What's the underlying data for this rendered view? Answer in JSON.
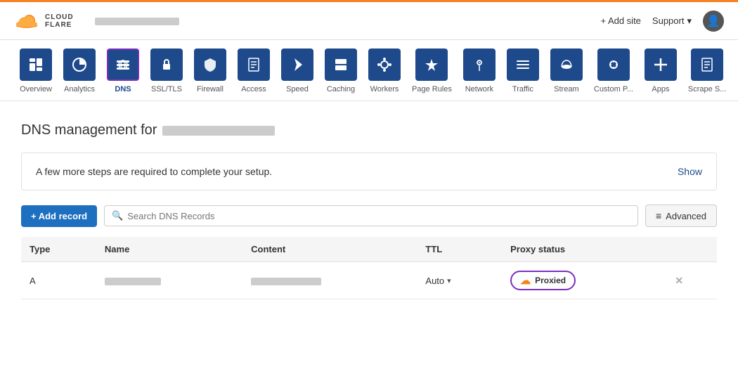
{
  "header": {
    "logo_text": "CLOUDFLARE",
    "site_name": "██████████",
    "add_site_label": "+ Add site",
    "support_label": "Support",
    "user_icon": "👤"
  },
  "nav": {
    "tabs": [
      {
        "id": "overview",
        "label": "Overview",
        "icon": "≡",
        "active": false
      },
      {
        "id": "analytics",
        "label": "Analytics",
        "icon": "◔",
        "active": false
      },
      {
        "id": "dns",
        "label": "DNS",
        "icon": "⊞",
        "active": true
      },
      {
        "id": "ssl-tls",
        "label": "SSL/TLS",
        "icon": "🔒",
        "active": false
      },
      {
        "id": "firewall",
        "label": "Firewall",
        "icon": "⊓",
        "active": false
      },
      {
        "id": "access",
        "label": "Access",
        "icon": "📄",
        "active": false
      },
      {
        "id": "speed",
        "label": "Speed",
        "icon": "⚡",
        "active": false
      },
      {
        "id": "caching",
        "label": "Caching",
        "icon": "⊟",
        "active": false
      },
      {
        "id": "workers",
        "label": "Workers",
        "icon": "◈",
        "active": false
      },
      {
        "id": "page-rules",
        "label": "Page Rules",
        "icon": "▽",
        "active": false
      },
      {
        "id": "network",
        "label": "Network",
        "icon": "📍",
        "active": false
      },
      {
        "id": "traffic",
        "label": "Traffic",
        "icon": "≡",
        "active": false
      },
      {
        "id": "stream",
        "label": "Stream",
        "icon": "☁",
        "active": false
      },
      {
        "id": "custom-pages",
        "label": "Custom P...",
        "icon": "🔧",
        "active": false
      },
      {
        "id": "apps",
        "label": "Apps",
        "icon": "✚",
        "active": false
      },
      {
        "id": "scrape-shield",
        "label": "Scrape S...",
        "icon": "📋",
        "active": false
      }
    ]
  },
  "main": {
    "page_title": "DNS management for",
    "setup_banner": {
      "text": "A few more steps are required to complete your setup.",
      "show_label": "Show"
    },
    "toolbar": {
      "add_record_label": "+ Add record",
      "search_placeholder": "Search DNS Records",
      "advanced_label": "Advanced"
    },
    "table": {
      "columns": [
        "Type",
        "Name",
        "Content",
        "TTL",
        "Proxy status"
      ],
      "rows": [
        {
          "type": "A",
          "name": "blur",
          "content": "blur",
          "ttl": "Auto",
          "proxy_status": "Proxied"
        }
      ]
    }
  }
}
